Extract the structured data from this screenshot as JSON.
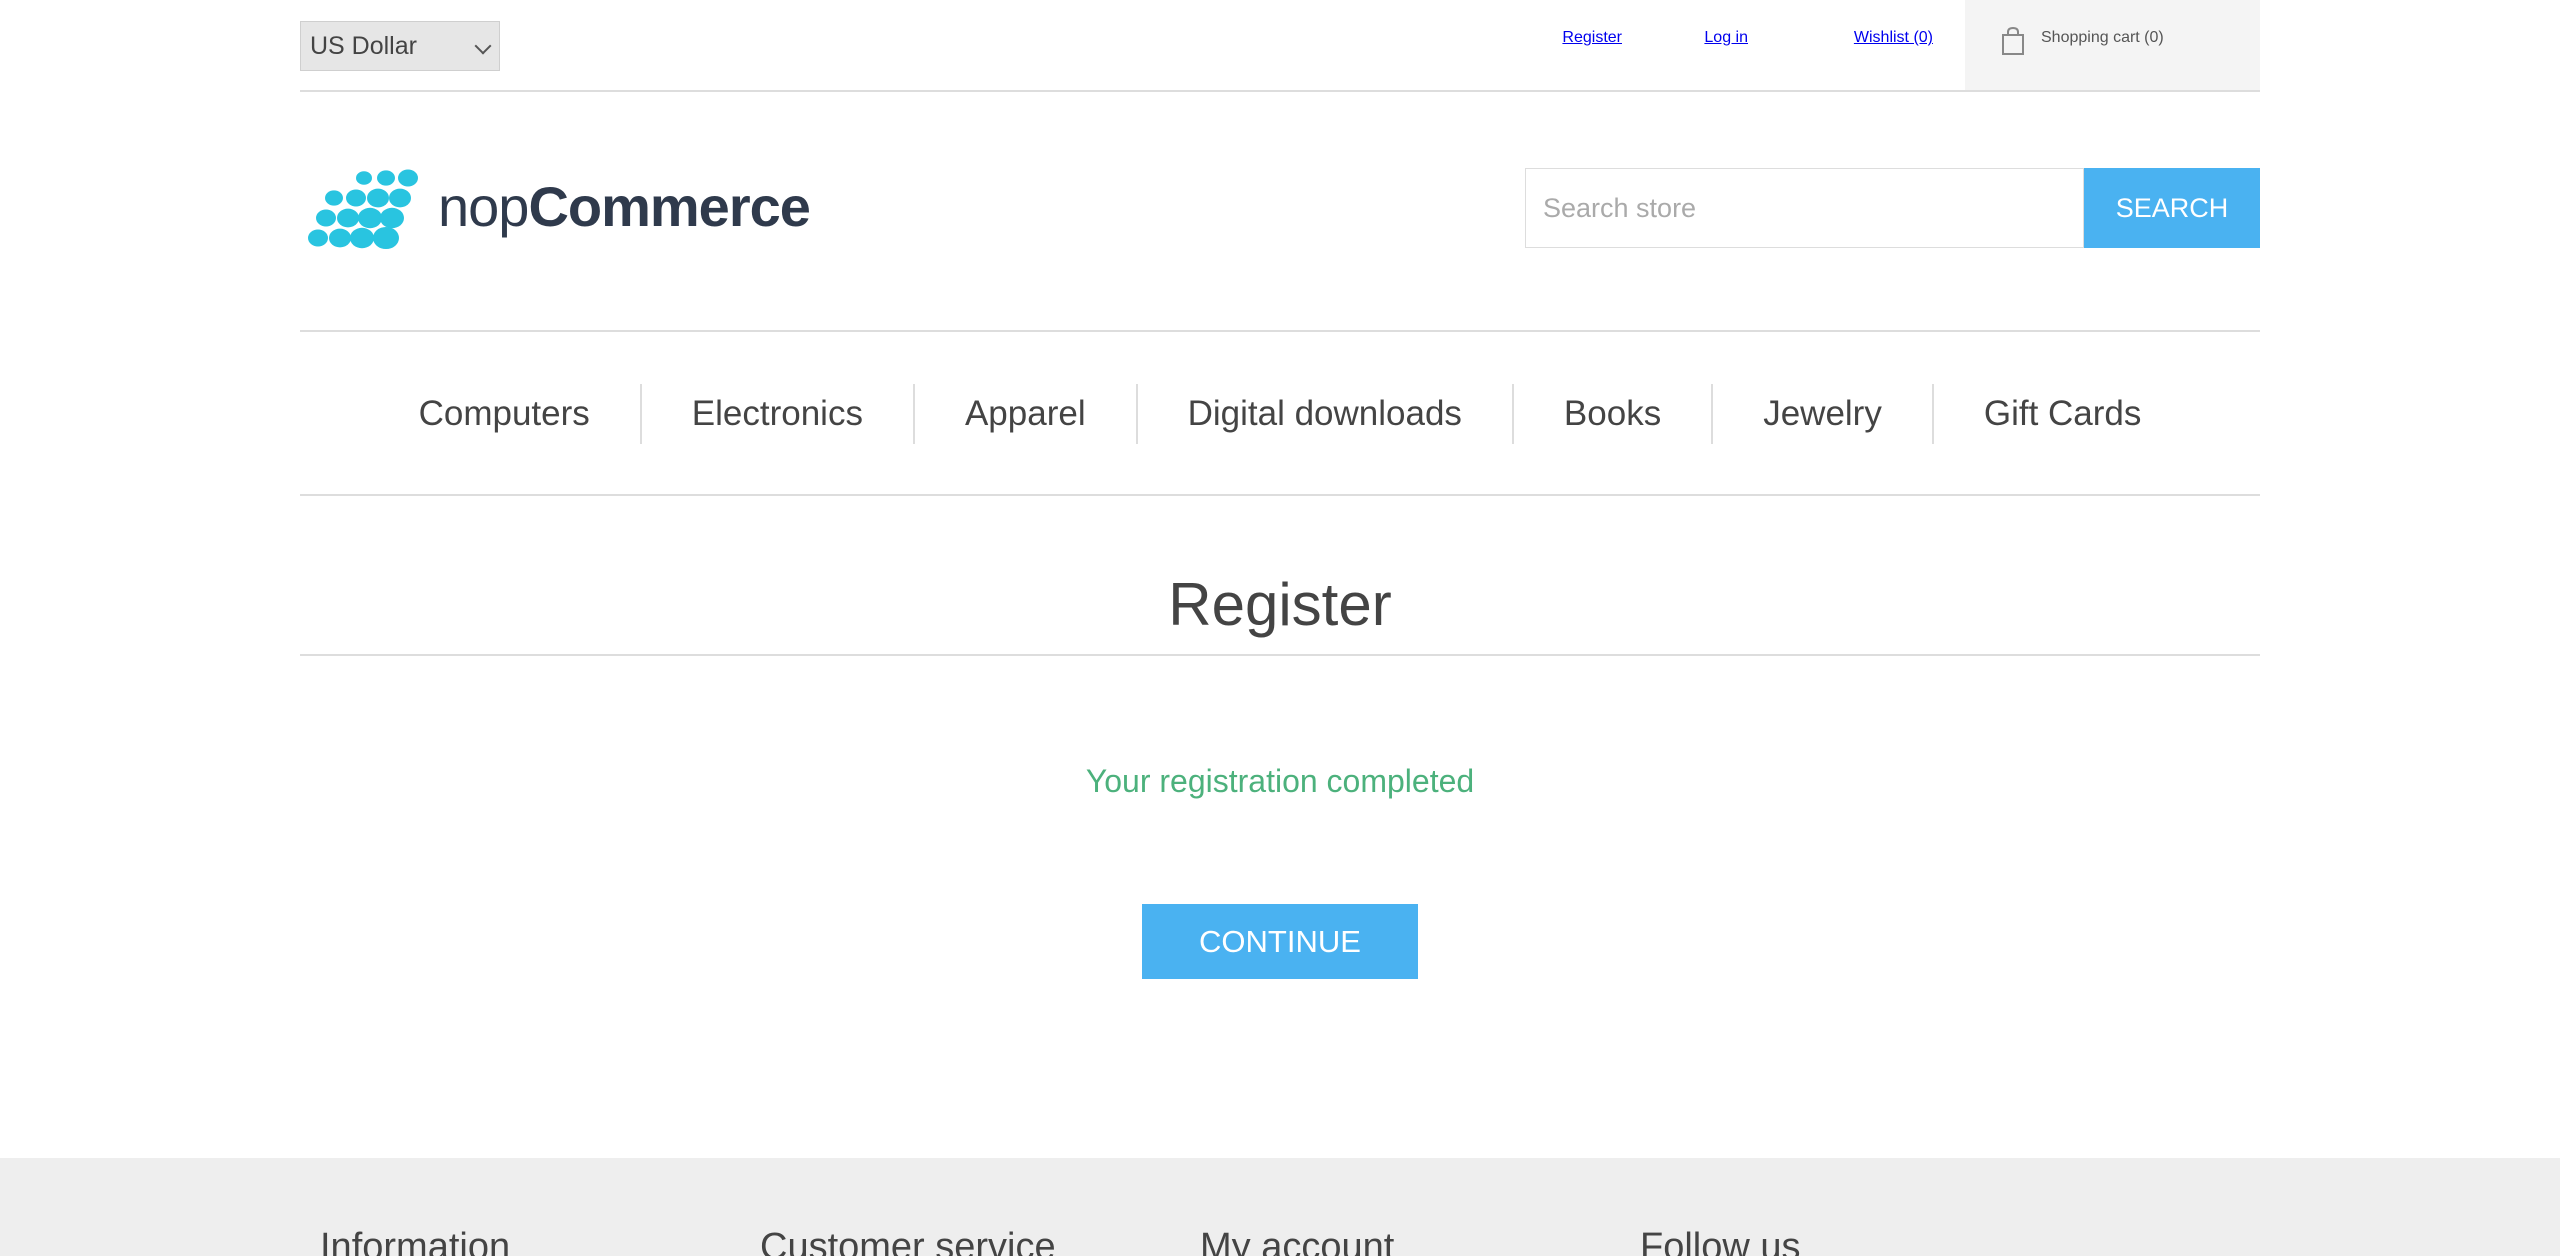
{
  "header": {
    "currency": "US Dollar",
    "links": {
      "register": "Register",
      "login": "Log in",
      "wishlist": "Wishlist (0)",
      "cart": "Shopping cart (0)"
    }
  },
  "logo": {
    "text_light": "nop",
    "text_bold": "Commerce"
  },
  "search": {
    "placeholder": "Search store",
    "button_label": "SEARCH"
  },
  "menu": {
    "items": [
      {
        "label": "Computers"
      },
      {
        "label": "Electronics"
      },
      {
        "label": "Apparel"
      },
      {
        "label": "Digital downloads"
      },
      {
        "label": "Books"
      },
      {
        "label": "Jewelry"
      },
      {
        "label": "Gift Cards"
      }
    ]
  },
  "page": {
    "title": "Register",
    "result": "Your registration completed",
    "continue_label": "CONTINUE"
  },
  "footer": {
    "columns": [
      {
        "title": "Information"
      },
      {
        "title": "Customer service"
      },
      {
        "title": "My account"
      },
      {
        "title": "Follow us"
      }
    ]
  },
  "colors": {
    "accent": "#4ab2f1",
    "success": "#4cb17c",
    "logo_dots": "#29c4e0",
    "logo_text": "#2f3a4c"
  }
}
